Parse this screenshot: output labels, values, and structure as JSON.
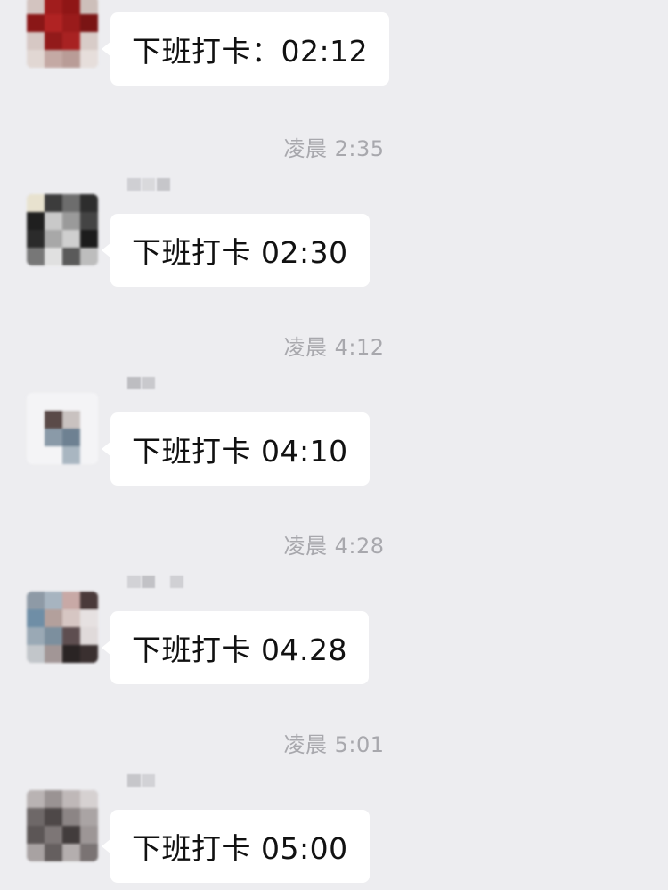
{
  "messages": [
    {
      "text": "下班打卡：02:12"
    },
    {
      "text": "下班打卡 02:30"
    },
    {
      "text": "下班打卡 04:10"
    },
    {
      "text": "下班打卡 04.28"
    },
    {
      "text": "下班打卡 05:00"
    }
  ],
  "timestamps": [
    "凌晨 2:35",
    "凌晨 4:12",
    "凌晨 4:28",
    "凌晨 5:01"
  ],
  "colors": {
    "background": "#ededf0",
    "bubble": "#ffffff",
    "text": "#111111",
    "timestamp": "#a8a8ad"
  }
}
